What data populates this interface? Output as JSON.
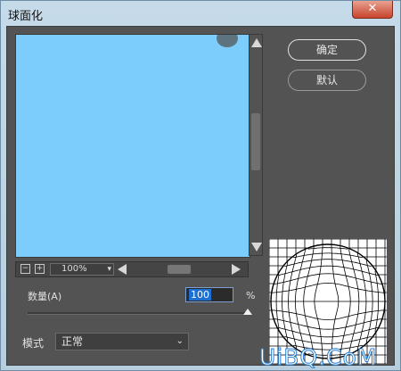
{
  "window": {
    "title": "球面化",
    "close_glyph": "✕"
  },
  "buttons": {
    "ok": "确定",
    "default": "默认"
  },
  "preview": {
    "zoom_value": "100%",
    "zoom_out": "−",
    "zoom_in": "+",
    "swatch_color": "#7ccdfb"
  },
  "amount": {
    "label": "数量(A)",
    "value": "100",
    "unit": "%",
    "slider_fraction": 0.97
  },
  "mode": {
    "label": "模式",
    "selected": "正常"
  },
  "watermark": {
    "text": "UiBQ.CoM"
  }
}
